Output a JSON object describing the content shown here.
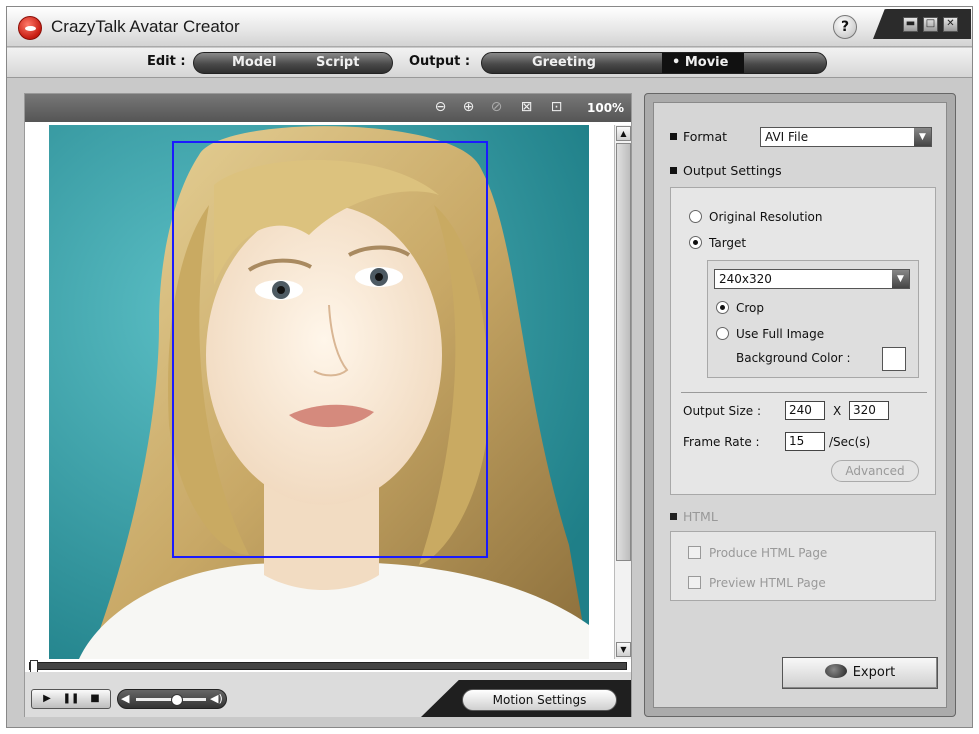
{
  "window": {
    "title": "CrazyTalk Avatar Creator",
    "help_label": "?",
    "minimize_label": "▬",
    "maximize_label": "□",
    "close_label": "✕"
  },
  "modebar": {
    "edit_label": "Edit :",
    "model_label": "Model",
    "script_label": "Script",
    "output_label": "Output :",
    "greeting_label": "Greeting",
    "movie_label": "• Movie",
    "active_mode": "Movie"
  },
  "preview": {
    "zoom_percent": "100%",
    "zoom_icons": [
      "zoom-out-icon",
      "zoom-in-icon",
      "reset-icon",
      "fit-icon",
      "actual-size-icon"
    ],
    "timeline_position": 0,
    "volume_level": 0.6,
    "motion_settings_label": "Motion Settings"
  },
  "output_panel": {
    "format_label": "Format",
    "format_value": "AVI File",
    "output_settings_label": "Output Settings",
    "original_resolution_label": "Original Resolution",
    "target_label": "Target",
    "resolution_selected": "target",
    "target_size_value": "240x320",
    "crop_label": "Crop",
    "use_full_image_label": "Use Full Image",
    "fit_mode_selected": "crop",
    "background_color_label": "Background Color :",
    "background_color": "#ffffff",
    "output_size_label": "Output Size :",
    "output_width": "240",
    "output_x": "X",
    "output_height": "320",
    "frame_rate_label": "Frame Rate :",
    "frame_rate_value": "15",
    "frame_rate_unit": "/Sec(s)",
    "advanced_label": "Advanced",
    "html_label": "HTML",
    "produce_html_label": "Produce HTML Page",
    "preview_html_label": "Preview HTML Page",
    "export_label": "Export"
  }
}
